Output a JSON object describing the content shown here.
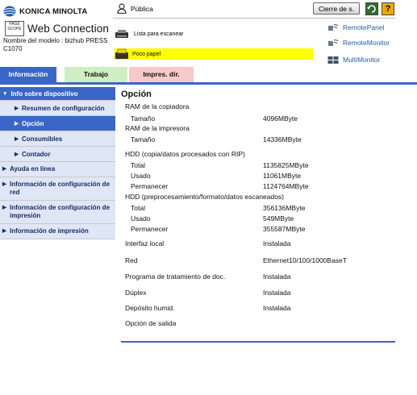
{
  "header": {
    "brand": "KONICA MINOLTA",
    "pagescope_logo": "PAGE SCOPE",
    "product": "Web Connection",
    "model_line1": "Nombre del modelo : bizhub PRESS",
    "model_line2": "C1070",
    "user_label": "Pública",
    "logout_label": "Cierre de s.",
    "help_label": "?"
  },
  "status": {
    "scan_list": "Lista para escanear",
    "low_paper": "Poco papel",
    "low_paper_color": "#ffff00"
  },
  "remote_links": [
    {
      "label": "RemotePanel"
    },
    {
      "label": "RemoteMonitor"
    },
    {
      "label": "MultiMonitor"
    }
  ],
  "tabs": [
    {
      "label": "Información"
    },
    {
      "label": "Trabajo"
    },
    {
      "label": "Impres. dir."
    }
  ],
  "sidebar": {
    "top": "Info sobre dispositivo",
    "subitems": [
      {
        "label": "Resumen de configuración"
      },
      {
        "label": "Opción"
      },
      {
        "label": "Consumibles"
      },
      {
        "label": "Contador"
      }
    ],
    "main": [
      {
        "label": "Ayuda en línea"
      },
      {
        "label": "Información de configuración de red"
      },
      {
        "label": "Información de configuración de impresión"
      },
      {
        "label": "Información de impresión"
      }
    ]
  },
  "content": {
    "title": "Opción",
    "copier_ram": "RAM de la copiadora",
    "copier_size_label": "Tamaño",
    "copier_size_value": "4096MByte",
    "printer_ram": "RAM de la impresora",
    "printer_size_label": "Tamaño",
    "printer_size_value": "14336MByte",
    "hdd1_title": "HDD (copia/datos procesados con RIP)",
    "hdd1_total_label": "Total",
    "hdd1_total_value": "1135825MByte",
    "hdd1_used_label": "Usado",
    "hdd1_used_value": "11061MByte",
    "hdd1_remain_label": "Permanecer",
    "hdd1_remain_value": "1124764MByte",
    "hdd2_title": "HDD (preprocesamiento/formato/datos escaneados)",
    "hdd2_total_label": "Total",
    "hdd2_total_value": "356136MByte",
    "hdd2_used_label": "Usado",
    "hdd2_used_value": "549MByte",
    "hdd2_remain_label": "Permanecer",
    "hdd2_remain_value": "355587MByte",
    "local_if_label": "Interfaz local",
    "local_if_value": "Instalada",
    "network_label": "Red",
    "network_value": "Ethernet10/100/1000BaseT",
    "docproc_label": "Programa de tratamiento de doc.",
    "docproc_value": "Instalada",
    "duplex_label": "Dúplex",
    "duplex_value": "Instalada",
    "humid_label": "Depósito humid.",
    "humid_value": "Instalada",
    "output_label": "Opción de salida"
  },
  "colors": {
    "accent": "#3a66c8",
    "sidebar_bg": "#dfe6f6",
    "job_tab": "#cfeec1",
    "print_tab": "#f7c9c9"
  }
}
